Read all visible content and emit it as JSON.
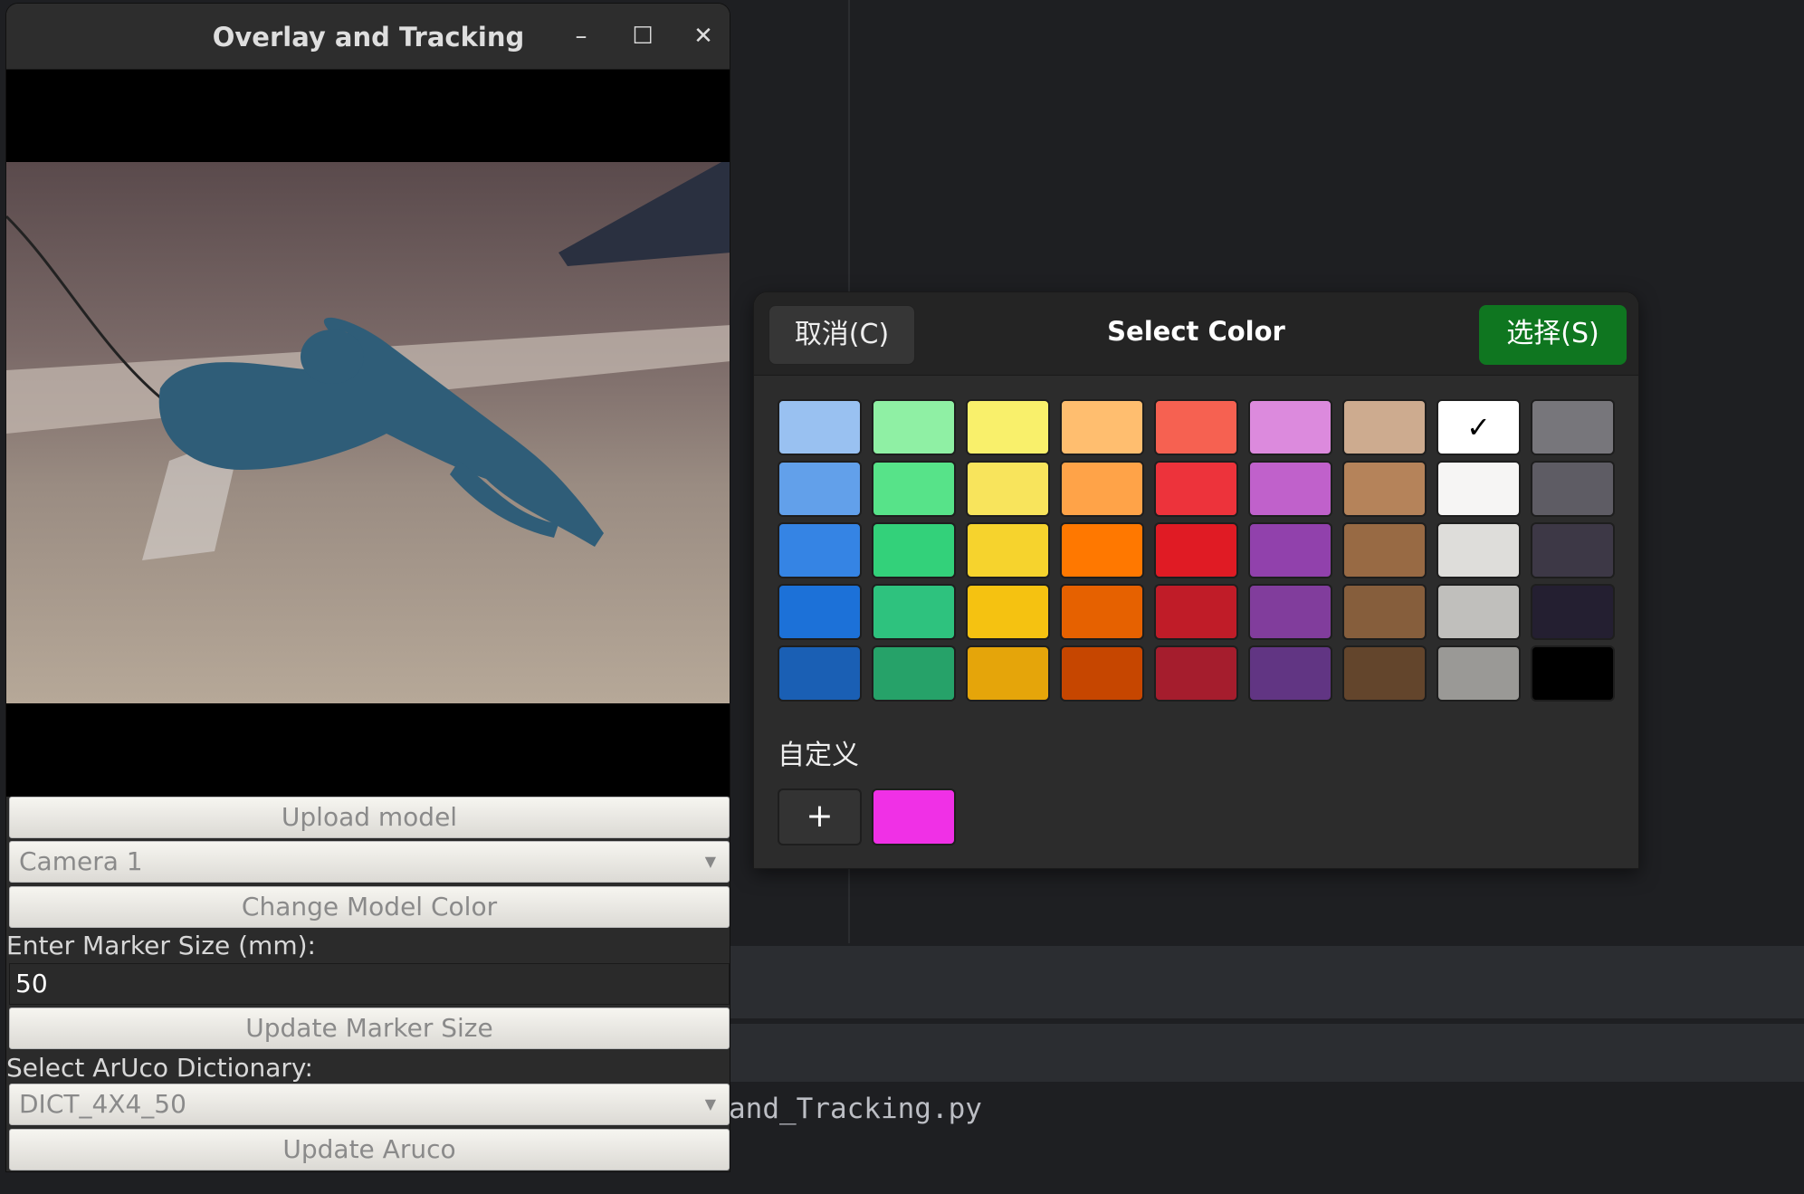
{
  "background": {
    "code_text": "and_Tracking.py"
  },
  "window": {
    "title": "Overlay and Tracking",
    "minimize": "–",
    "maximize": "☐",
    "close": "✕",
    "upload_button": "Upload model",
    "camera_select": "Camera 1",
    "change_color_button": "Change Model Color",
    "marker_label": "Enter Marker Size (mm):",
    "marker_value": "50",
    "update_marker_button": "Update Marker Size",
    "dict_label": "Select ArUco Dictionary:",
    "dict_select": "DICT_4X4_50",
    "update_aruco_button": "Update Aruco",
    "dropdown_arrow": "▼"
  },
  "dialog": {
    "title": "Select Color",
    "cancel": "取消(C)",
    "select": "选择(S)",
    "custom_label": "自定义",
    "add_icon": "+",
    "check": "✓",
    "selected_index": 7,
    "palette": [
      [
        "#99c1f1",
        "#8ff0a4",
        "#f9f06b",
        "#ffbe6f",
        "#f66151",
        "#dc8add",
        "#cdab8f",
        "#ffffff",
        "#77767b"
      ],
      [
        "#62a0ea",
        "#57e389",
        "#f8e45c",
        "#ffa348",
        "#ed333b",
        "#c061cb",
        "#b5835a",
        "#f6f5f4",
        "#5e5c64"
      ],
      [
        "#3584e4",
        "#33d17a",
        "#f6d32d",
        "#ff7800",
        "#e01b24",
        "#9141ac",
        "#986a44",
        "#deddda",
        "#3d3846"
      ],
      [
        "#1c71d8",
        "#2ec27e",
        "#f5c211",
        "#e66100",
        "#c01c28",
        "#813d9c",
        "#865e3c",
        "#c0bfbc",
        "#241f31"
      ],
      [
        "#1a5fb4",
        "#26a269",
        "#e5a50a",
        "#c64600",
        "#a51d2d",
        "#613583",
        "#63452c",
        "#9a9996",
        "#000000"
      ]
    ],
    "custom_colors": [
      "#f030e6"
    ]
  }
}
